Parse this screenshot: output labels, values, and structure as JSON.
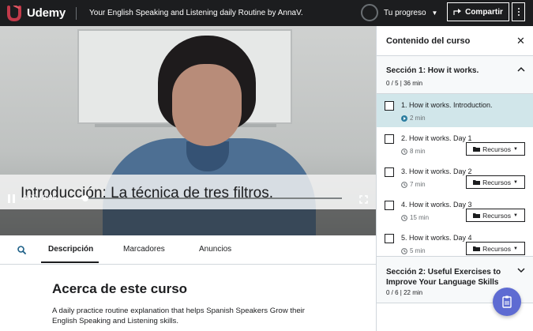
{
  "topbar": {
    "brand": "Udemy",
    "course_title": "Your English Speaking and Listening daily Routine by AnnaV.",
    "progress_label": "Tu progreso",
    "share_label": "Compartir"
  },
  "video": {
    "subtitle": "Introducción: La técnica de tres filtros.",
    "time": "0:09 / 2:25",
    "progress_fraction": 0.062
  },
  "tabs": [
    {
      "label": "Descripción"
    },
    {
      "label": "Marcadores"
    },
    {
      "label": "Anuncios"
    }
  ],
  "about": {
    "title": "Acerca de este curso",
    "text": "A daily practice routine explanation that helps Spanish Speakers Grow their English Speaking and Listening skills."
  },
  "sidebar": {
    "title": "Contenido del curso",
    "sections": [
      {
        "title": "Sección 1: How it works.",
        "meta": "0 / 5 | 36 min",
        "lectures": [
          {
            "title": "1. How it works. Introduction.",
            "duration": "2 min",
            "resources": ""
          },
          {
            "title": "2. How it works. Day 1",
            "duration": "8 min",
            "resources": "Recursos"
          },
          {
            "title": "3. How it works. Day 2",
            "duration": "7 min",
            "resources": "Recursos"
          },
          {
            "title": "4. How it works. Day 3",
            "duration": "15 min",
            "resources": "Recursos"
          },
          {
            "title": "5. How it works. Day 4",
            "duration": "5 min",
            "resources": "Recursos"
          }
        ]
      },
      {
        "title": "Sección 2: Useful Exercises to Improve Your Language Skills",
        "meta": "0 / 6 | 22 min"
      }
    ]
  },
  "colors": {
    "topbar": "#1c1d1f",
    "current_lecture": "#d1e6ea",
    "accent_purple": "#5e6bd2",
    "brand_red": "#a435f0",
    "play_icon": "#2d7ea0"
  },
  "icons": {
    "logo": "udemy-u-logo",
    "share": "share-arrow-icon",
    "more": "kebab-menu-icon",
    "search": "search-icon",
    "close": "close-icon",
    "folder": "folder-icon",
    "play": "play-circle-icon",
    "clock": "clock-icon",
    "fab": "notes-icon"
  }
}
